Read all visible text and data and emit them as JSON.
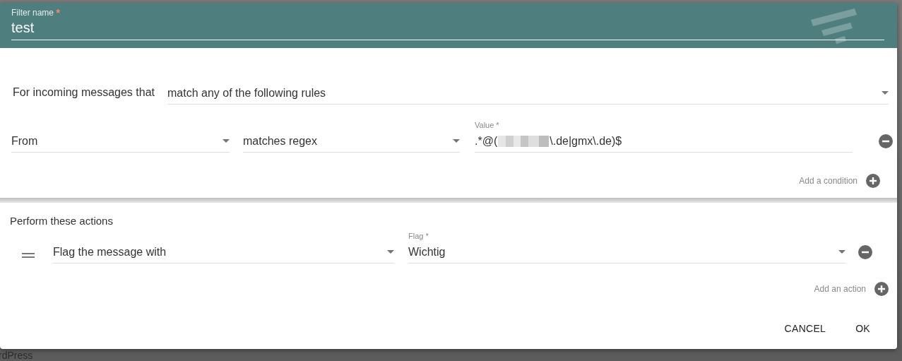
{
  "dialog": {
    "filter_name": {
      "label": "Filter name",
      "required_mark": "*",
      "value": "test"
    },
    "conditions": {
      "intro": "For incoming messages that",
      "match_mode": "match any of the following rules",
      "rules": [
        {
          "field": "From",
          "operator": "matches regex",
          "value_label": "Value *",
          "value_start": ".*@(",
          "value_end": "\\.de|gmx\\.de)$"
        }
      ],
      "add_label": "Add a condition"
    },
    "actions": {
      "heading": "Perform these actions",
      "items": [
        {
          "action": "Flag the message with",
          "param_label": "Flag *",
          "param": "Wichtig"
        }
      ],
      "add_label": "Add an action"
    },
    "buttons": [
      "CANCEL",
      "OK"
    ]
  },
  "background_text": "rdPress"
}
